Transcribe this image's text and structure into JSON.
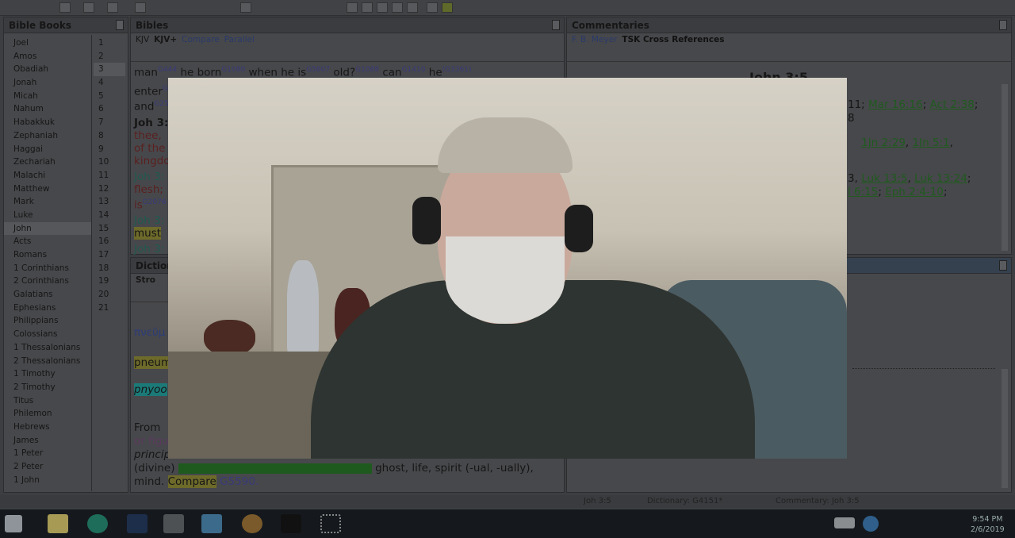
{
  "bible_books": {
    "title": "Bible Books",
    "books": [
      "Joel",
      "Amos",
      "Obadiah",
      "Jonah",
      "Micah",
      "Nahum",
      "Habakkuk",
      "Zephaniah",
      "Haggai",
      "Zechariah",
      "Malachi",
      "Matthew",
      "Mark",
      "Luke",
      "John",
      "Acts",
      "Romans",
      "1 Corinthians",
      "2 Corinthians",
      "Galatians",
      "Ephesians",
      "Philippians",
      "Colossians",
      "1 Thessalonians",
      "2 Thessalonians",
      "1 Timothy",
      "2 Timothy",
      "Titus",
      "Philemon",
      "Hebrews",
      "James",
      "1 Peter",
      "2 Peter",
      "1 John"
    ],
    "selected": "John",
    "chapters": [
      "1",
      "2",
      "3",
      "4",
      "5",
      "6",
      "7",
      "8",
      "9",
      "10",
      "11",
      "12",
      "13",
      "14",
      "15",
      "16",
      "17",
      "18",
      "19",
      "20",
      "21"
    ],
    "selected_chapter": "3"
  },
  "bibles": {
    "title": "Bibles",
    "tabs": [
      "KJV",
      "KJV+",
      "Compare",
      "Parallel"
    ],
    "active_tab": "KJV+",
    "line1": [
      [
        "man",
        "G444"
      ],
      [
        "he born",
        "G1080"
      ],
      [
        "when he is",
        "G5607"
      ],
      [
        "old?",
        "G1088"
      ],
      [
        "can",
        "G1410"
      ],
      [
        "he",
        "(G3361)"
      ]
    ],
    "fragments": [
      "enter",
      "and",
      "Joh 3:",
      "thee,",
      "of the",
      "kingdo",
      "Joh 3:",
      "flesh;",
      "is",
      "Joh 3:",
      "must",
      "Joh 3:"
    ],
    "frag_sup": [
      "G",
      "G25",
      "G2076"
    ]
  },
  "dictionary": {
    "title": "Diction",
    "tab": "Stro",
    "greek": "πνεῦμ",
    "translit": "pneum",
    "pron": "pnyoo",
    "lines": [
      "From",
      "or figu",
      "princip"
    ],
    "divine": "(divine)",
    "rest": "ghost, life, spirit (-ual, -ually),",
    "mind": "mind.",
    "compare": "Compare",
    "ref": "G5590."
  },
  "commentaries": {
    "title": "Commentaries",
    "tabs": [
      "F. B. Meyer",
      "TSK Cross References"
    ],
    "active_tab": "TSK Cross References",
    "heading": "John 3:5",
    "row1_pre": "11;",
    "row1": [
      "Mar 16:16",
      "Act 2:38"
    ],
    "row2": "8",
    "row3": [
      "1Jn 2:29",
      "1Jn 5:1"
    ],
    "row4_pre": "3,",
    "row4": [
      "Luk 13:5",
      "Luk 13:24"
    ],
    "row5": [
      "l 6:15",
      "Eph 2:4-10"
    ]
  },
  "status": {
    "verse": "Joh 3:5",
    "dictionary": "Dictionary: G4151*",
    "commentary": "Commentary: Joh 3:5"
  },
  "clock": {
    "time": "9:54 PM",
    "date": "2/6/2019"
  },
  "taskbar": {
    "apps": [
      "start",
      "file-explorer",
      "e-sword",
      "app-m",
      "snipping-tool",
      "e-sword-blue",
      "chrome",
      "webcam",
      "screen-capture"
    ]
  },
  "colors": {
    "highlight_green": "#1e5a1e",
    "highlight_yellow": "#6d6a2a",
    "highlight_teal": "#1b7a78",
    "highlight_purple": "#6a4a6e"
  }
}
